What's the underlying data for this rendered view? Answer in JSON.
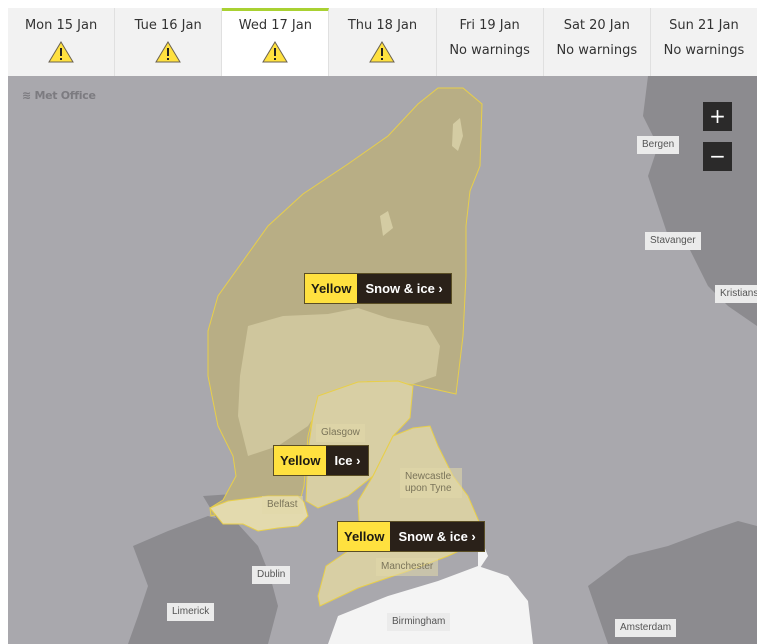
{
  "tabs": [
    {
      "day": "Mon 15 Jan",
      "status": "warning",
      "status_text": null,
      "active": false
    },
    {
      "day": "Tue 16 Jan",
      "status": "warning",
      "status_text": null,
      "active": false
    },
    {
      "day": "Wed 17 Jan",
      "status": "warning",
      "status_text": null,
      "active": true
    },
    {
      "day": "Thu 18 Jan",
      "status": "warning",
      "status_text": null,
      "active": false
    },
    {
      "day": "Fri 19 Jan",
      "status": "none",
      "status_text": "No warnings",
      "active": false
    },
    {
      "day": "Sat 20 Jan",
      "status": "none",
      "status_text": "No warnings",
      "active": false
    },
    {
      "day": "Sun 21 Jan",
      "status": "none",
      "status_text": "No warnings",
      "active": false
    }
  ],
  "map": {
    "brand": "Met Office",
    "zoom_in": "+",
    "zoom_out": "−",
    "cities": {
      "bergen": "Bergen",
      "stavanger": "Stavanger",
      "kristiansand": "Kristians",
      "glasgow": "Glasgow",
      "belfast": "Belfast",
      "newcastle": "Newcastle upon Tyne",
      "manchester": "Manchester",
      "dublin": "Dublin",
      "limerick": "Limerick",
      "birmingham": "Birmingham",
      "amsterdam": "Amsterdam"
    },
    "warnings": [
      {
        "level": "Yellow",
        "type": "Snow & ice ›"
      },
      {
        "level": "Yellow",
        "type": "Ice ›"
      },
      {
        "level": "Yellow",
        "type": "Snow & ice ›"
      }
    ]
  },
  "colors": {
    "active_tab_accent": "#a9d132",
    "warning_yellow": "#ffe13f",
    "warning_dark": "#2a2119",
    "sea": "#a9a8ad",
    "land": "#8c8b8f",
    "warning_area": "#b8ae85"
  }
}
